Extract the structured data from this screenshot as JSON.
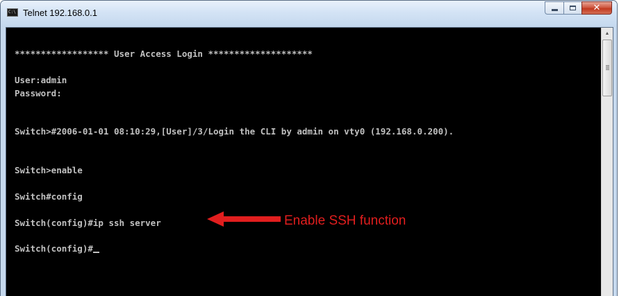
{
  "window": {
    "title": "Telnet 192.168.0.1",
    "app_icon_label": "C:\\",
    "buttons": {
      "minimize": "minimize",
      "maximize": "maximize",
      "close": "✕"
    }
  },
  "console": {
    "lines": [
      "****************** User Access Login ********************",
      "User:admin",
      "Password:",
      "Switch>#2006-01-01 08:10:29,[User]/3/Login the CLI by admin on vty0 (192.168.0.200).",
      "Switch>enable",
      "Switch#config",
      "Switch(config)#ip ssh server",
      "Switch(config)#"
    ],
    "text_color": "#c0c0c0",
    "background": "#000000"
  },
  "annotation": {
    "text": "Enable SSH function",
    "color": "#e11e1e"
  }
}
